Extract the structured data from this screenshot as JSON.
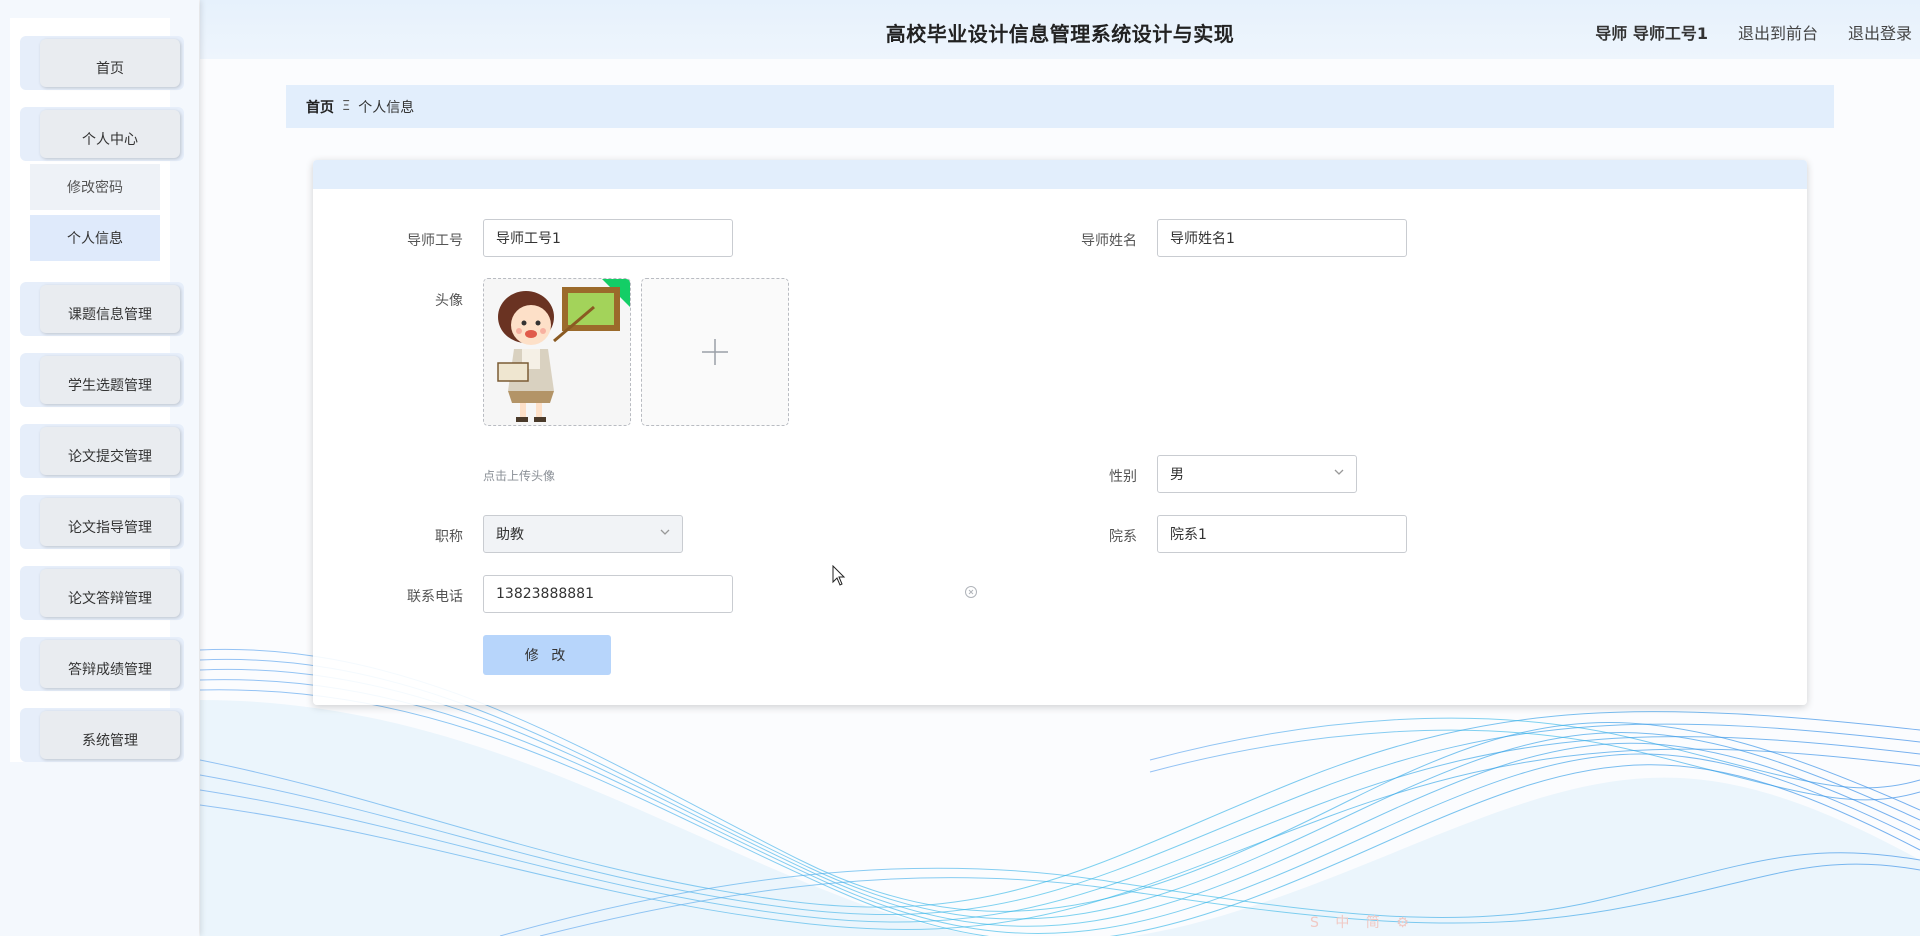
{
  "header": {
    "title": "高校毕业设计信息管理系统设计与实现",
    "user": "导师 导师工号1",
    "to_front": "退出到前台",
    "logout": "退出登录"
  },
  "sidebar": {
    "items": [
      {
        "label": "首页"
      },
      {
        "label": "个人中心"
      },
      {
        "label": "修改密码"
      },
      {
        "label": "个人信息"
      },
      {
        "label": "课题信息管理"
      },
      {
        "label": "学生选题管理"
      },
      {
        "label": "论文提交管理"
      },
      {
        "label": "论文指导管理"
      },
      {
        "label": "论文答辩管理"
      },
      {
        "label": "答辩成绩管理"
      },
      {
        "label": "系统管理"
      }
    ]
  },
  "breadcrumb": {
    "home": "首页",
    "sep": "Ξ",
    "current": "个人信息"
  },
  "form": {
    "teacher_id": {
      "label": "导师工号",
      "value": "导师工号1"
    },
    "teacher_name": {
      "label": "导师姓名",
      "value": "导师姓名1"
    },
    "avatar": {
      "label": "头像",
      "tip": "点击上传头像"
    },
    "gender": {
      "label": "性别",
      "value": "男"
    },
    "title": {
      "label": "职称",
      "value": "助教"
    },
    "department": {
      "label": "院系",
      "value": "院系1"
    },
    "phone": {
      "label": "联系电话",
      "value": "13823888881"
    },
    "submit": "修 改"
  },
  "tray_icons": [
    "sougou-icon",
    "chinese-input-icon",
    "moon-icon",
    "dots-icon",
    "keyboard-icon",
    "user-icon",
    "simplified-icon",
    "shirt-icon",
    "gear-icon"
  ],
  "tray_text": "中 简",
  "colors": {
    "header_bg": "#e6f1fc",
    "breadcrumb_bg": "#e2eefc",
    "button_bg": "#b7d5fb",
    "wave": "#29a9e0"
  }
}
